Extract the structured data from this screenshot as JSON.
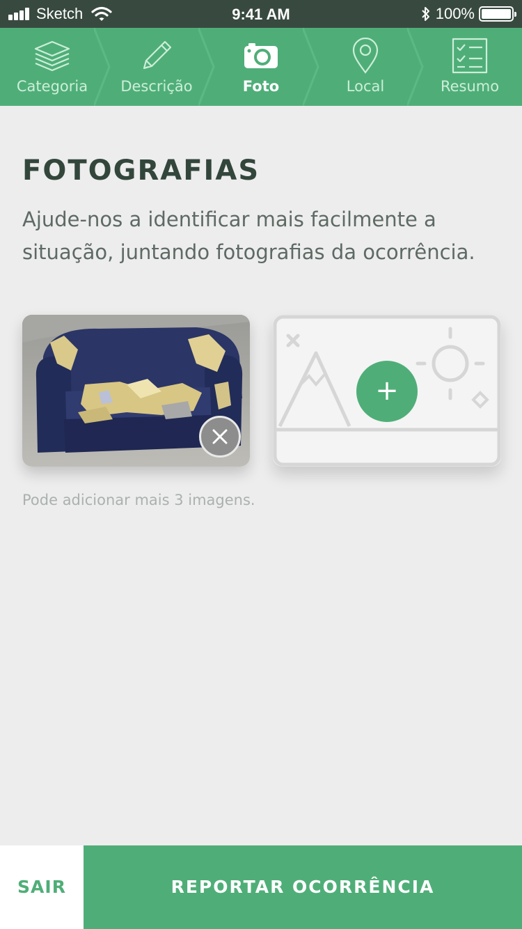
{
  "status_bar": {
    "carrier": "Sketch",
    "time": "9:41 AM",
    "battery": "100%"
  },
  "steps": [
    {
      "label": "Categoria",
      "icon": "layers-icon",
      "active": false
    },
    {
      "label": "Descrição",
      "icon": "pencil-icon",
      "active": false
    },
    {
      "label": "Foto",
      "icon": "camera-icon",
      "active": true
    },
    {
      "label": "Local",
      "icon": "map-pin-icon",
      "active": false
    },
    {
      "label": "Resumo",
      "icon": "checklist-icon",
      "active": false
    }
  ],
  "main": {
    "title": "FOTOGRAFIAS",
    "description": "Ajude-nos a identificar mais facilmente a situação, juntando fotografias da ocorrência.",
    "add_symbol": "+",
    "hint": "Pode adicionar mais 3 imagens."
  },
  "footer": {
    "exit_label": "SAIR",
    "report_label": "REPORTAR OCORRÊNCIA"
  },
  "colors": {
    "accent": "#4fae78",
    "status_bar": "#384a40",
    "title": "#33463c"
  }
}
